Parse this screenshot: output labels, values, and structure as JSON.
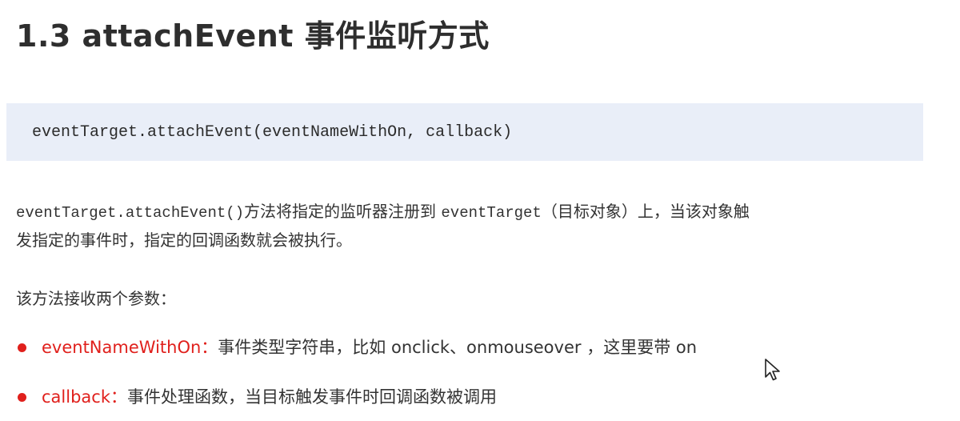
{
  "title": "1.3 attachEvent 事件监听方式",
  "code": {
    "syntax": "eventTarget.attachEvent(eventNameWithOn, callback)"
  },
  "description": {
    "method": "eventTarget.attachEvent()",
    "text1": "方法将指定的监听器注册到 ",
    "target": "eventTarget",
    "text2": "（目标对象）上，当该对象触",
    "line2": "发指定的事件时，指定的回调函数就会被执行。"
  },
  "params_intro": "该方法接收两个参数：",
  "params": [
    {
      "name": "eventNameWithOn：",
      "description": "事件类型字符串，比如 onclick、onmouseover ，这里要带 on"
    },
    {
      "name": "callback：",
      "description": "事件处理函数，当目标触发事件时回调函数被调用"
    }
  ],
  "icons": {
    "bullet": "red-dot-bullet-icon",
    "cursor": "mouse-pointer-icon"
  },
  "colors": {
    "accent": "#e0201c",
    "code_background": "#e9eef8",
    "text": "#333333"
  }
}
